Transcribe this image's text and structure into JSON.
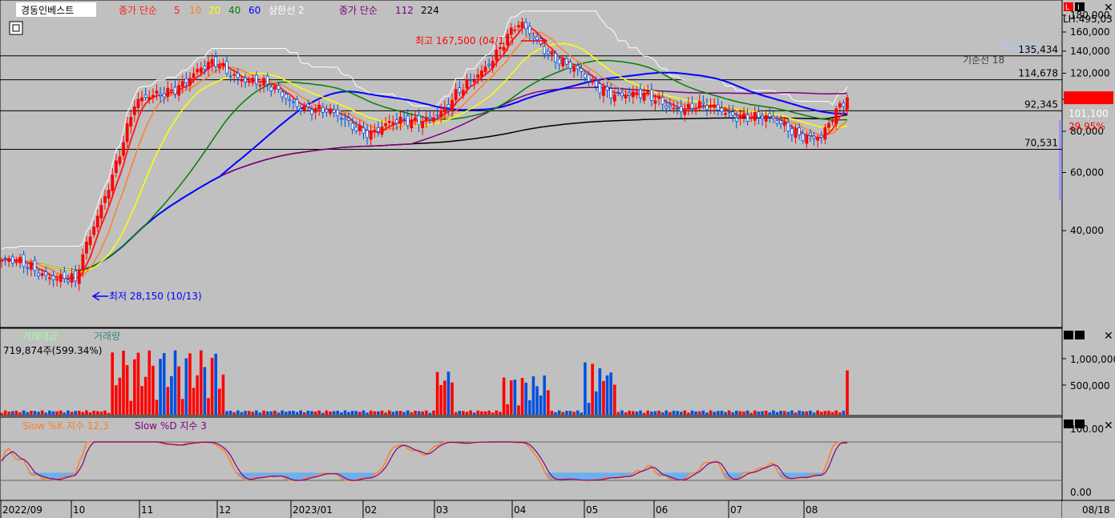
{
  "legend": {
    "stock_name": "경동인베스트",
    "ma_prefix": "종가 단순",
    "ma_periods": [
      "5",
      "10",
      "20",
      "40",
      "60"
    ],
    "ma_colors": [
      "#ff2020",
      "#ff7f27",
      "#ffff00",
      "#008000",
      "#0000ff"
    ],
    "upper_band": "상한선 2",
    "long_ma_prefix": "종가 단순",
    "long_periods": [
      "112",
      "224"
    ],
    "long_colors": [
      "#800080",
      "#000000"
    ]
  },
  "price_axis": {
    "ticks": [
      "180,000",
      "160,000",
      "140,000",
      "120,000",
      "100,000",
      "80,000",
      "60,000",
      "40,000"
    ],
    "lh_label": "LH:495,03",
    "current_price": "101,100",
    "change_pct": "29.95%",
    "base_line_label": "기준선 18",
    "base_line_value": "90,400"
  },
  "annotations": {
    "high": "최고 167,500 (04/17)",
    "low": "최저 28,150 (10/13)"
  },
  "h_lines": [
    {
      "value": 135434,
      "label": "135,434"
    },
    {
      "value": 114678,
      "label": "114,678"
    },
    {
      "value": 92345,
      "label": "92,345"
    },
    {
      "value": 70531,
      "label": "70,531"
    }
  ],
  "volume_panel": {
    "title_amount": "거래대금",
    "title_volume": "거래량",
    "current": "719,874주(599.34%)",
    "ticks": [
      "1,000,000",
      "500,000"
    ]
  },
  "stoch_panel": {
    "k_label": "Slow %K 지수 12,3",
    "d_label": "Slow %D 지수 3",
    "ticks": [
      "100.00",
      "0.00"
    ]
  },
  "x_axis": {
    "labels": [
      "2022/09",
      "10",
      "11",
      "12",
      "2023/01",
      "02",
      "03",
      "04",
      "05",
      "06",
      "07",
      "08"
    ],
    "right_date": "08/18"
  },
  "colors": {
    "up": "#ff0000",
    "down": "#0050e0",
    "background": "#c0c0c0"
  },
  "chart_data": {
    "type": "candlestick",
    "price_range": [
      22000,
      185000
    ],
    "price_scale": "log",
    "high": 167500,
    "low": 28150,
    "current": 101100,
    "key_points": [
      {
        "date": "2022/09",
        "close": 32500
      },
      {
        "date": "2022/10/13",
        "close": 28150
      },
      {
        "date": "2022/11",
        "close": 95000
      },
      {
        "date": "2022/12",
        "close": 128000
      },
      {
        "date": "2023/01",
        "close": 98000
      },
      {
        "date": "2023/02",
        "close": 80000
      },
      {
        "date": "2023/03",
        "close": 92000
      },
      {
        "date": "2023/04/17",
        "close": 167500
      },
      {
        "date": "2023/05",
        "close": 110000
      },
      {
        "date": "2023/06",
        "close": 96000
      },
      {
        "date": "2023/07",
        "close": 90000
      },
      {
        "date": "2023/08",
        "close": 76000
      },
      {
        "date": "2023/08/18",
        "close": 101100
      }
    ],
    "volume_range": [
      0,
      1300000
    ],
    "stoch_range": [
      0,
      100
    ]
  }
}
